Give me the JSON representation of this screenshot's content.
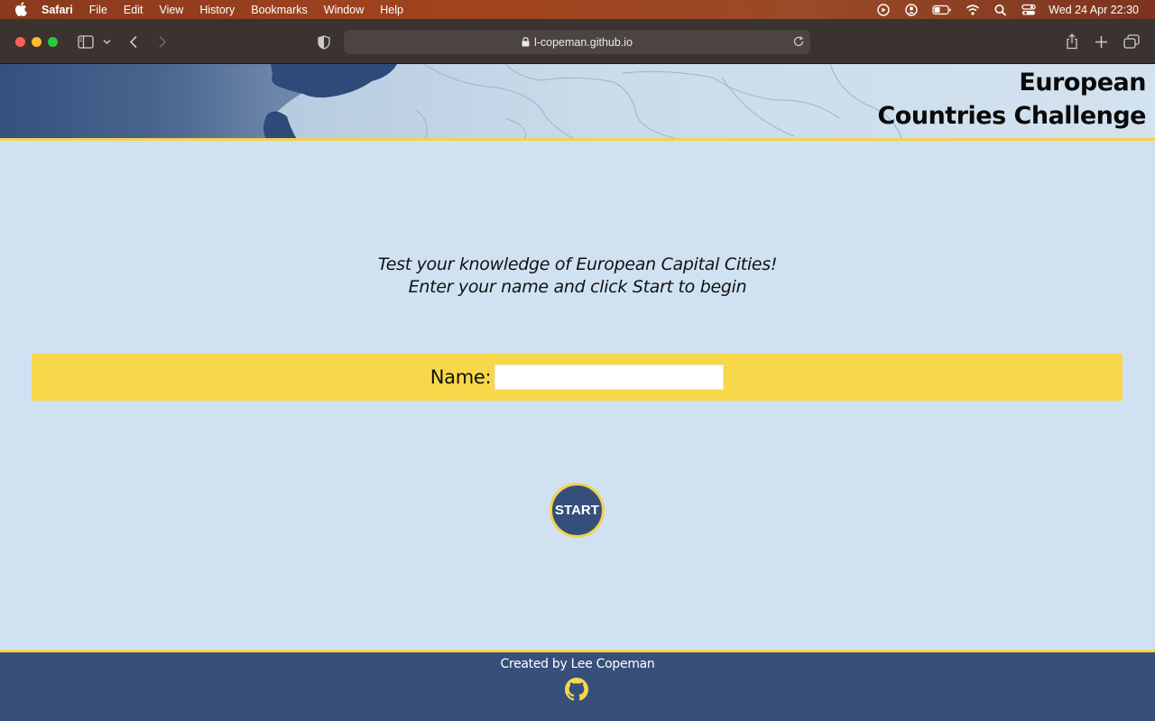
{
  "menubar": {
    "app_name": "Safari",
    "items": [
      "File",
      "Edit",
      "View",
      "History",
      "Bookmarks",
      "Window",
      "Help"
    ],
    "clock": "Wed 24 Apr  22:30"
  },
  "browser": {
    "url": "l-copeman.github.io"
  },
  "site": {
    "title_line1": "European",
    "title_line2": "Countries Challenge",
    "intro_line1": "Test your knowledge of European Capital Cities!",
    "intro_line2": "Enter your name and click Start to begin",
    "name_label": "Name:",
    "name_value": "",
    "start_label": "START",
    "footer_credit": "Created by Lee Copeman"
  },
  "colors": {
    "page_bg": "#d0e2f2",
    "accent_yellow": "#f8d84a",
    "navy": "#374f7b"
  }
}
